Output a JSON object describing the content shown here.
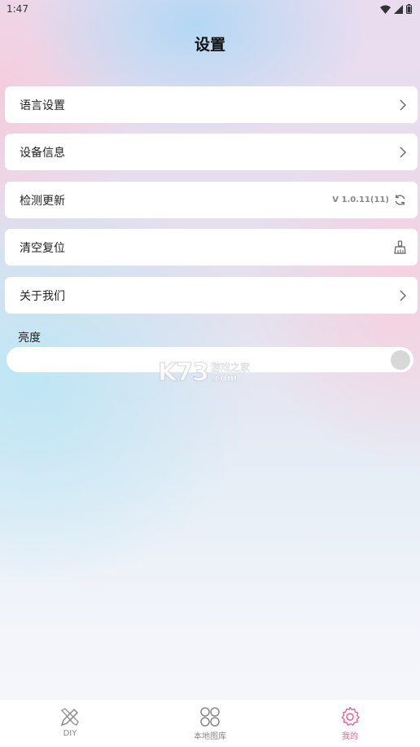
{
  "status_bar": {
    "time": "1:47",
    "icons": [
      "wifi-icon",
      "signal-icon",
      "battery-icon"
    ]
  },
  "header": {
    "title": "设置"
  },
  "settings": [
    {
      "label": "语言设置",
      "right_icon": "chevron-right-icon"
    },
    {
      "label": "设备信息",
      "right_icon": "chevron-right-icon"
    },
    {
      "label": "检测更新",
      "value": "V 1.0.11(11)",
      "right_icon": "refresh-icon"
    },
    {
      "label": "清空复位",
      "right_icon": "broom-icon"
    },
    {
      "label": "关于我们",
      "right_icon": "chevron-right-icon"
    }
  ],
  "brightness": {
    "label": "亮度",
    "level": 1.0
  },
  "watermark": {
    "big": "K73",
    "cn": "游戏之家",
    "com": ".com"
  },
  "tab_bar": {
    "tabs": [
      {
        "label": "DIY",
        "icon": "diy-icon",
        "active": false
      },
      {
        "label": "本地图库",
        "icon": "grid-icon",
        "active": false
      },
      {
        "label": "我的",
        "icon": "gear-icon",
        "active": true
      }
    ]
  },
  "colors": {
    "accent": "#e8638f",
    "row_bg": "#ffffff",
    "inactive": "#888888"
  }
}
